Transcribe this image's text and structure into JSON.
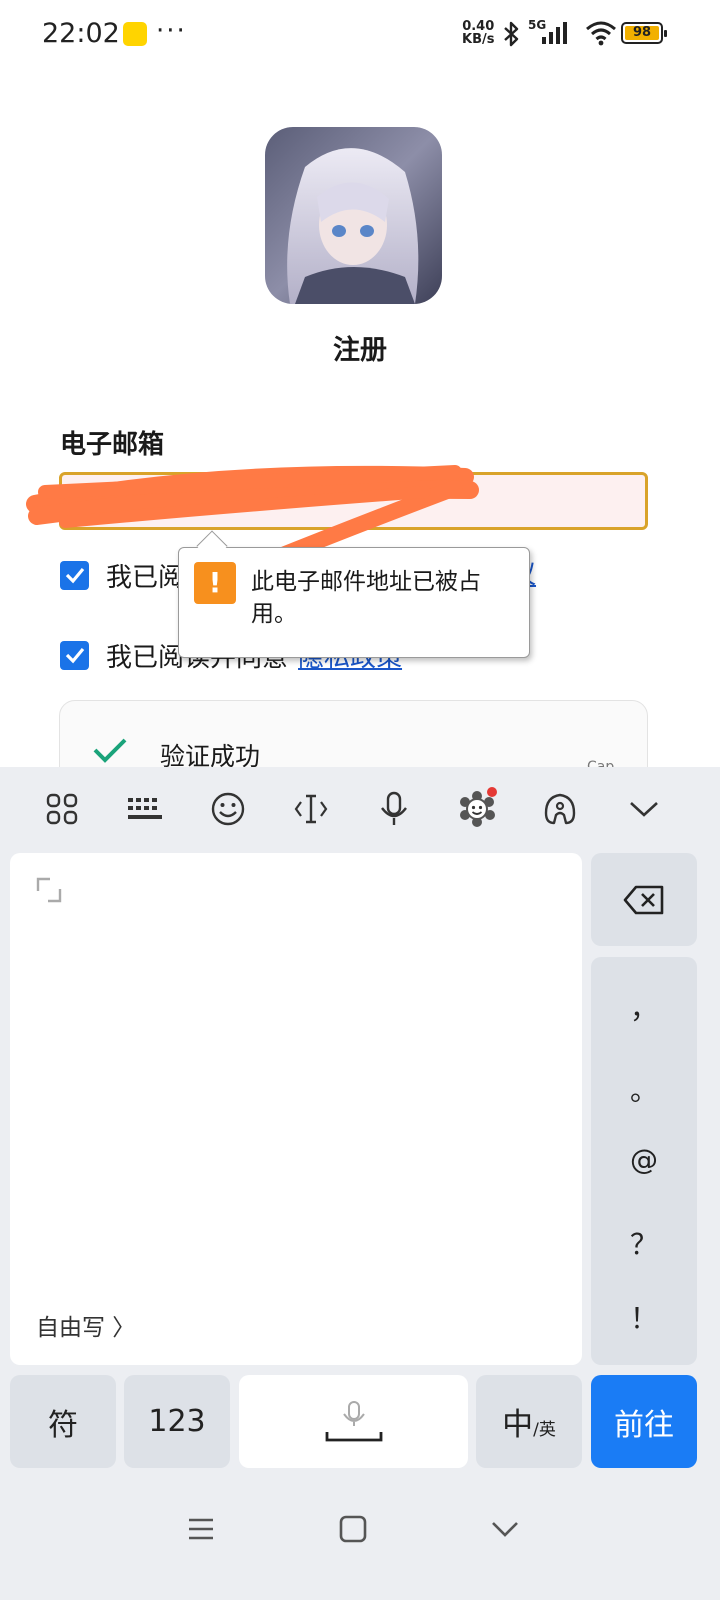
{
  "status_bar": {
    "time": "22:02",
    "dots": "···",
    "net_speed_value": "0.40",
    "net_speed_unit": "KB/s",
    "network": "5G",
    "battery": "98",
    "icons": [
      "app-icon",
      "bluetooth-icon",
      "signal-icon",
      "wifi-icon",
      "battery-icon"
    ]
  },
  "page": {
    "title": "注册",
    "email_label": "电子邮箱",
    "checkboxes": [
      {
        "text": "我已阅",
        "link": "议",
        "checked": true
      },
      {
        "text": "我已阅读并同意",
        "link": "隐私政策",
        "checked": true
      }
    ],
    "tooltip": {
      "icon": "!",
      "message": "此电子邮件地址已被占用。"
    },
    "captcha": {
      "text": "验证成功",
      "corner": "Cap"
    }
  },
  "keyboard": {
    "toolbar_icons": [
      "grid-icon",
      "keyboard-icon",
      "emoji-icon",
      "text-cursor-icon",
      "microphone-icon",
      "skin-icon",
      "ai-assistant-icon",
      "collapse-icon"
    ],
    "handwrite_label": "自由写 〉",
    "punctuation": [
      "，",
      "。",
      "@",
      "？",
      "！"
    ],
    "keys": {
      "symbol": "符",
      "numbers": "123",
      "lang_main": "中",
      "lang_sub": "/英",
      "go": "前往"
    }
  },
  "colors": {
    "accent": "#1a7cf5",
    "checkbox": "#1a73e8",
    "warning": "#f7901e",
    "input_border": "#d9a32a",
    "redaction": "#ff7a45"
  }
}
